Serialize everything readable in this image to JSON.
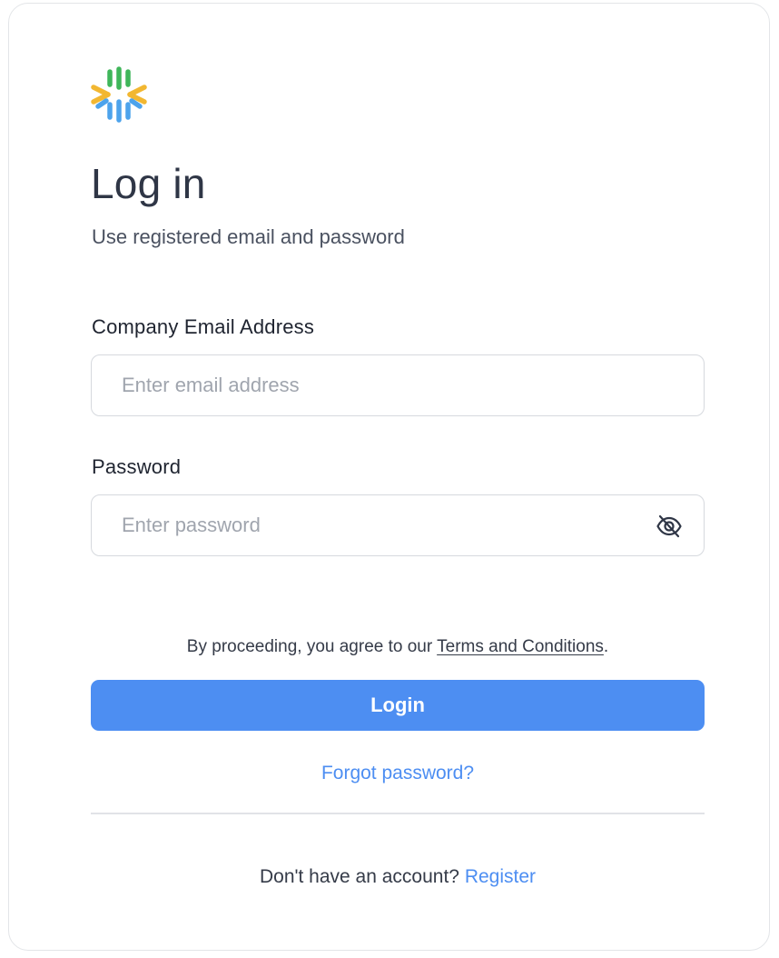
{
  "login": {
    "title": "Log in",
    "subtitle": "Use registered email and password",
    "email": {
      "label": "Company Email Address",
      "placeholder": "Enter email address",
      "value": ""
    },
    "password": {
      "label": "Password",
      "placeholder": "Enter password",
      "value": "",
      "toggle_icon": "eye-off-icon"
    },
    "terms": {
      "prefix": "By proceeding, you agree to our ",
      "link": "Terms and Conditions",
      "suffix": "."
    },
    "login_button": "Login",
    "forgot_link": "Forgot password?",
    "register": {
      "prompt": "Don't have an account? ",
      "link": "Register"
    }
  },
  "colors": {
    "accent": "#4d8ef2",
    "logo_green": "#3fb65a",
    "logo_yellow": "#f2b731",
    "logo_blue": "#4da3ec"
  },
  "icons": {
    "logo": "snowflake-logo-icon",
    "password_toggle": "eye-off-icon"
  }
}
